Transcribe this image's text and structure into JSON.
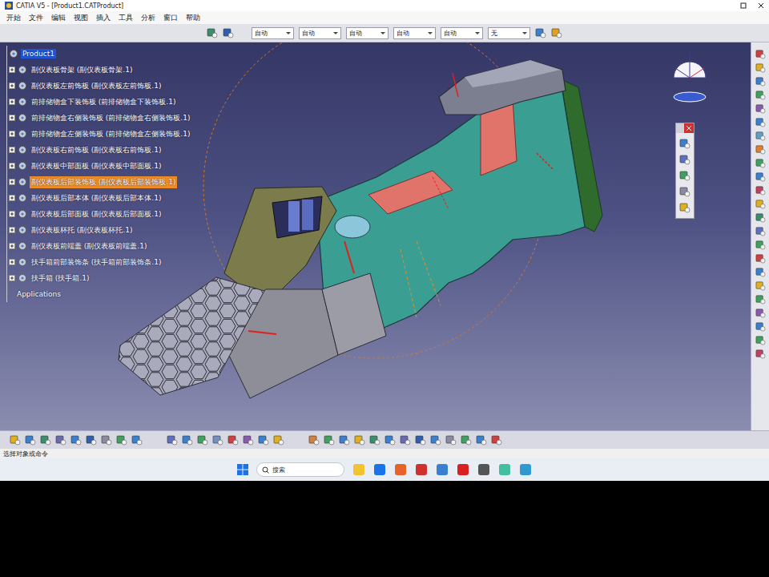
{
  "window": {
    "title": "CATIA V5 - [Product1.CATProduct]"
  },
  "menu": [
    "开始",
    "文件",
    "编辑",
    "视图",
    "插入",
    "工具",
    "分析",
    "窗口",
    "帮助"
  ],
  "toolbar": {
    "fields": [
      "自动",
      "自动",
      "自动",
      "自动",
      "自动",
      "无"
    ]
  },
  "tree": {
    "root": {
      "label": "Product1",
      "selected": true
    },
    "items": [
      {
        "label": "副仪表板骨架 (副仪表板骨架.1)",
        "selected": false
      },
      {
        "label": "副仪表板左前饰板 (副仪表板左前饰板.1)",
        "selected": false
      },
      {
        "label": "前排储物盒下装饰板 (前排储物盒下装饰板.1)",
        "selected": false
      },
      {
        "label": "前排储物盒右侧装饰板 (前排储物盒右侧装饰板.1)",
        "selected": false
      },
      {
        "label": "前排储物盒左侧装饰板 (前排储物盒左侧装饰板.1)",
        "selected": false
      },
      {
        "label": "副仪表板右前饰板 (副仪表板右前饰板.1)",
        "selected": false
      },
      {
        "label": "副仪表板中部面板 (副仪表板中部面板.1)",
        "selected": false
      },
      {
        "label": "副仪表板后部装饰板 (副仪表板后部装饰板.1)",
        "selected": true
      },
      {
        "label": "副仪表板后部本体 (副仪表板后部本体.1)",
        "selected": false
      },
      {
        "label": "副仪表板后部面板 (副仪表板后部面板.1)",
        "selected": false
      },
      {
        "label": "副仪表板杯托 (副仪表板杯托.1)",
        "selected": false
      },
      {
        "label": "副仪表板前端盖 (副仪表板前端盖.1)",
        "selected": false
      },
      {
        "label": "扶手箱前部装饰条 (扶手箱前部装饰条.1)",
        "selected": false
      },
      {
        "label": "扶手箱 (扶手箱.1)",
        "selected": false
      }
    ],
    "footer": "Applications"
  },
  "status_bar": {
    "text": "选择对象或命令"
  },
  "taskbar": {
    "search": "搜索"
  }
}
